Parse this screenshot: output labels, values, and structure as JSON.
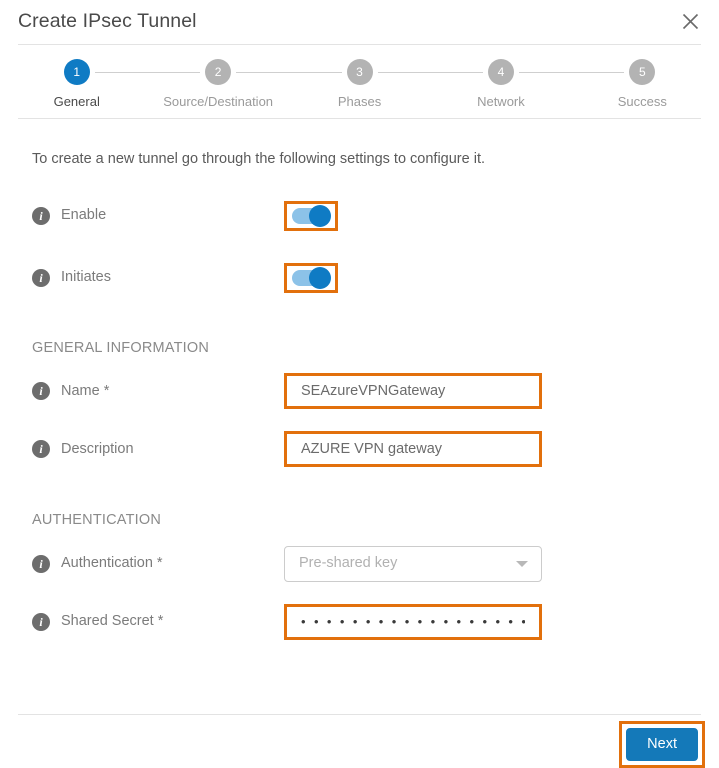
{
  "header": {
    "title": "Create IPsec Tunnel",
    "close_icon": "close-icon"
  },
  "stepper": {
    "steps": [
      {
        "number": "1",
        "label": "General",
        "state": "active"
      },
      {
        "number": "2",
        "label": "Source/Destination",
        "state": "inactive"
      },
      {
        "number": "3",
        "label": "Phases",
        "state": "inactive"
      },
      {
        "number": "4",
        "label": "Network",
        "state": "inactive"
      },
      {
        "number": "5",
        "label": "Success",
        "state": "inactive"
      }
    ]
  },
  "body": {
    "intro": "To create a new tunnel go through the following settings to configure it.",
    "toggles": [
      {
        "label": "Enable",
        "state": "on",
        "info_icon": "info-icon"
      },
      {
        "label": "Initiates",
        "state": "on",
        "info_icon": "info-icon"
      }
    ],
    "sections": {
      "general": {
        "heading": "GENERAL INFORMATION",
        "fields": [
          {
            "label": "Name *",
            "value": "SEAzureVPNGateway",
            "placeholder": "",
            "info_icon": "info-icon"
          },
          {
            "label": "Description",
            "value": "AZURE VPN gateway",
            "placeholder": "",
            "info_icon": "info-icon"
          }
        ]
      },
      "authentication": {
        "heading": "AUTHENTICATION",
        "method": {
          "label": "Authentication *",
          "selected": "Pre-shared key",
          "caret_icon": "chevron-down-icon",
          "info_icon": "info-icon"
        },
        "secret": {
          "label": "Shared Secret *",
          "value": "• • • • • • • • • • • • • • • • • • • • • • • •",
          "info_icon": "info-icon"
        }
      }
    }
  },
  "footer": {
    "next_label": "Next"
  },
  "colors": {
    "accent_blue": "#0f7bc4",
    "button_blue": "#1479b9",
    "highlight_orange": "#e2700c",
    "step_inactive_gray": "#b3b3b3",
    "info_icon_gray": "#6d6d6d",
    "toggle_track_blue": "#8cc2e8"
  }
}
